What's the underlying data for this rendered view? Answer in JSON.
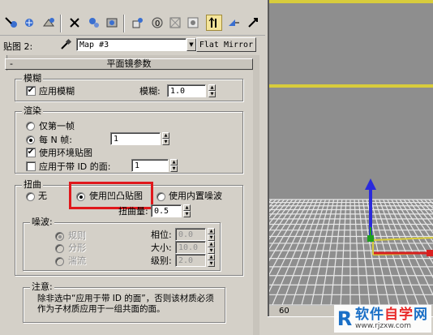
{
  "toolbar": {
    "icons": [
      "pick-material-icon",
      "put-to-scene-icon",
      "assign-material-icon",
      "reset-map-icon",
      "make-unique-icon",
      "put-to-library-icon",
      "material-effects-channel-icon",
      "show-map-in-viewport-icon",
      "show-end-result-icon",
      "go-to-parent-icon",
      "go-forward-to-sibling-icon"
    ]
  },
  "material_row": {
    "label": "贴图 2:",
    "map_name": "Map #3",
    "type_button": "Flat Mirror"
  },
  "rollout": {
    "collapse_symbol": "-",
    "title": "平面镜参数",
    "blur": {
      "group_title": "模糊",
      "apply_blur_label": "应用模糊",
      "apply_blur_checked": true,
      "blur_amount_label": "模糊:",
      "blur_amount_value": "1.0"
    },
    "render": {
      "group_title": "渲染",
      "first_frame_label": "仅第一帧",
      "every_nth_label": "每 N 帧:",
      "every_nth_value": "1",
      "every_nth_selected": true,
      "use_env_map_label": "使用环境贴图",
      "use_env_map_checked": true,
      "apply_faces_label": "应用于带 ID 的面:",
      "apply_faces_value": "1",
      "apply_faces_checked": false
    },
    "distortion": {
      "group_title": "扭曲",
      "none_label": "无",
      "bump_label": "使用凹凸贴图",
      "builtin_noise_label": "使用内置噪波",
      "selected": "bump",
      "amount_label": "扭曲量:",
      "amount_value": "0.5"
    },
    "noise": {
      "group_title": "噪波:",
      "regular_label": "规则",
      "fractal_label": "分形",
      "turbulence_label": "湍流",
      "phase_label": "相位:",
      "phase_value": "0.0",
      "size_label": "大小:",
      "size_value": "10.0",
      "levels_label": "级别:",
      "levels_value": "2.0"
    },
    "note": {
      "group_title": "注意:",
      "text": "除非选中“应用于带 ID 的面”，否则该材质必须作为子材质应用于一组共面的面。"
    }
  },
  "viewport": {
    "timeline_tick": "60"
  },
  "watermark": {
    "mark": "R",
    "main_a": "软件",
    "main_b": "自学",
    "main_c": "网",
    "url": "www.rjzxw.com"
  },
  "colors": {
    "panel": "#d4d0c8",
    "highlight_box": "#e0181c",
    "viewport_grid_line": "#e8e8e8",
    "axis_z": "#2a2adc",
    "axis_x": "#d82020",
    "axis_y": "#20a020",
    "selection_yellow": "#d8cc3c"
  }
}
